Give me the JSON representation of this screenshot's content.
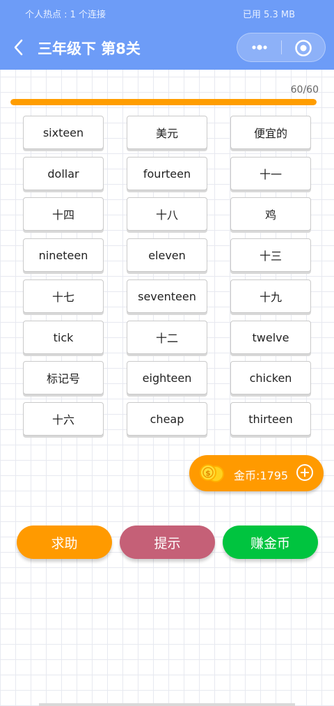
{
  "status_bar": {
    "hotspot": "个人热点 : 1 个连接",
    "data_used": "已用 5.3 MB"
  },
  "nav": {
    "title": "三年级下 第8关"
  },
  "progress": {
    "text": "60/60",
    "current": 60,
    "total": 60
  },
  "cards": [
    "sixteen",
    "美元",
    "便宜的",
    "dollar",
    "fourteen",
    "十一",
    "十四",
    "十八",
    "鸡",
    "nineteen",
    "eleven",
    "十三",
    "十七",
    "seventeen",
    "十九",
    "tick",
    "十二",
    "twelve",
    "标记号",
    "eighteen",
    "chicken",
    "十六",
    "cheap",
    "thirteen"
  ],
  "coins": {
    "label": "金币:1795"
  },
  "actions": {
    "help": "求助",
    "hint": "提示",
    "earn": "赚金币"
  },
  "colors": {
    "nav": "#6d9cf7",
    "accent": "#ff9a00",
    "hint": "#c56077",
    "earn": "#00c43f"
  }
}
